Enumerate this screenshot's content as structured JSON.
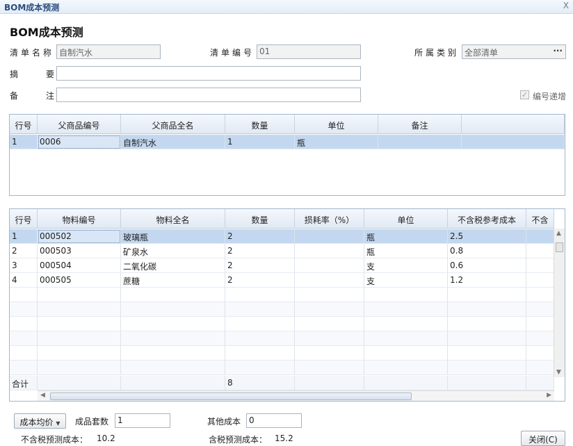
{
  "window": {
    "title": "BOM成本预测",
    "close_glyph": "X"
  },
  "page_title": "BOM成本预测",
  "form": {
    "list_name_label": "清单名称",
    "list_name_value": "自制汽水",
    "list_no_label": "清单编号",
    "list_no_value": "01",
    "category_label": "所属类别",
    "category_value": "全部清单",
    "category_button": "···",
    "summary_label": "摘　要",
    "summary_value": "",
    "remark_label": "备　注",
    "remark_value": "",
    "auto_increment_label": "编号递增",
    "auto_increment_checked": true
  },
  "parent_grid": {
    "headers": [
      "行号",
      "父商品编号",
      "父商品全名",
      "数量",
      "单位",
      "备注"
    ],
    "rows": [
      {
        "line": "1",
        "code": "0006",
        "name": "自制汽水",
        "qty": "1",
        "unit": "瓶",
        "note": ""
      }
    ]
  },
  "material_grid": {
    "headers": [
      "行号",
      "物料编号",
      "物料全名",
      "数量",
      "损耗率（%）",
      "单位",
      "不含税参考成本",
      "不含"
    ],
    "rows": [
      {
        "line": "1",
        "code": "000502",
        "name": "玻璃瓶",
        "qty": "2",
        "loss": "",
        "unit": "瓶",
        "cost": "2.5"
      },
      {
        "line": "2",
        "code": "000503",
        "name": "矿泉水",
        "qty": "2",
        "loss": "",
        "unit": "瓶",
        "cost": "0.8"
      },
      {
        "line": "3",
        "code": "000504",
        "name": "二氧化碳",
        "qty": "2",
        "loss": "",
        "unit": "支",
        "cost": "0.6"
      },
      {
        "line": "4",
        "code": "000505",
        "name": "蔗糖",
        "qty": "2",
        "loss": "",
        "unit": "支",
        "cost": "1.2"
      }
    ],
    "total_label": "合计",
    "total_qty": "8"
  },
  "footer": {
    "cost_method": "成本均价",
    "product_sets_label": "成品套数",
    "product_sets_value": "1",
    "other_cost_label": "其他成本",
    "other_cost_value": "0",
    "excl_tax_label": "不含税预测成本：",
    "excl_tax_value": "10.2",
    "incl_tax_label": "含税预测成本：",
    "incl_tax_value": "15.2",
    "close_button": "关闭(C)"
  }
}
